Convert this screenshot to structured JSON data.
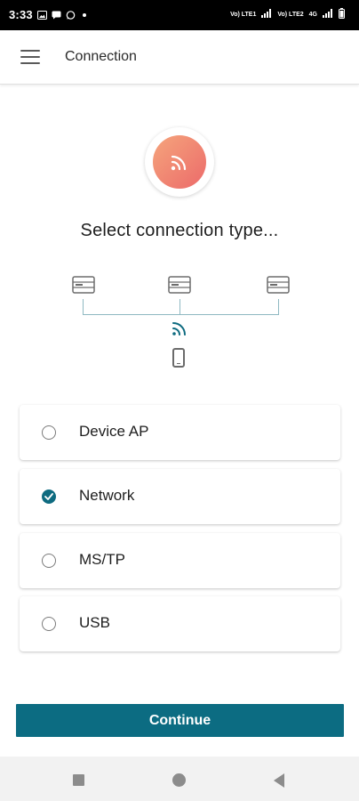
{
  "status_bar": {
    "time": "3:33",
    "notification_icons": [
      "gallery-icon",
      "messaging-icon",
      "whatsapp-icon",
      "dot-icon"
    ],
    "sim1_label": "Vo) LTE1",
    "sim2_label": "Vo) LTE2",
    "network_type": "4G",
    "system_icons": [
      "signal-icon",
      "signal-icon",
      "battery-icon"
    ]
  },
  "app_bar": {
    "title": "Connection",
    "menu_icon": "hamburger-menu-icon"
  },
  "hero": {
    "icon": "wifi-icon",
    "gradient": [
      "#f5a57c",
      "#ec6a6a"
    ]
  },
  "prompt": "Select connection type...",
  "diagram": {
    "device_icons": [
      "server-icon",
      "server-icon",
      "server-icon"
    ],
    "link_icon": "wifi-icon",
    "client_icon": "phone-icon",
    "line_color": "#8fb9c2"
  },
  "options": [
    {
      "label": "Device AP",
      "selected": false
    },
    {
      "label": "Network",
      "selected": true
    },
    {
      "label": "MS/TP",
      "selected": false
    },
    {
      "label": "USB",
      "selected": false
    }
  ],
  "continue_label": "Continue",
  "accent_color": "#0c6c82",
  "nav_bar": {
    "icons": [
      "recents-square-icon",
      "home-circle-icon",
      "back-triangle-icon"
    ]
  }
}
